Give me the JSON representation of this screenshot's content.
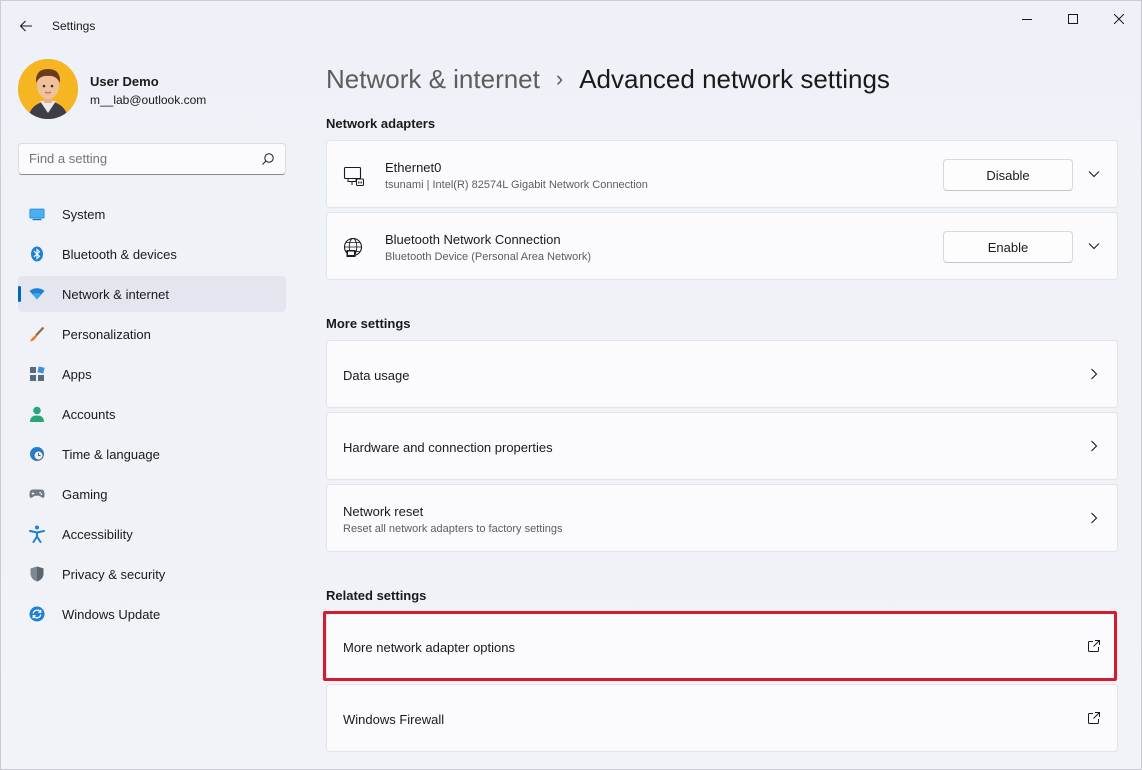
{
  "app": {
    "title": "Settings"
  },
  "profile": {
    "name": "User Demo",
    "email": "m__lab@outlook.com"
  },
  "search": {
    "placeholder": "Find a setting"
  },
  "sidebar": {
    "items": [
      {
        "label": "System",
        "icon": "system-icon"
      },
      {
        "label": "Bluetooth & devices",
        "icon": "bluetooth-icon"
      },
      {
        "label": "Network & internet",
        "icon": "wifi-icon",
        "active": true
      },
      {
        "label": "Personalization",
        "icon": "brush-icon"
      },
      {
        "label": "Apps",
        "icon": "apps-icon"
      },
      {
        "label": "Accounts",
        "icon": "person-icon"
      },
      {
        "label": "Time & language",
        "icon": "globe-clock-icon"
      },
      {
        "label": "Gaming",
        "icon": "gamepad-icon"
      },
      {
        "label": "Accessibility",
        "icon": "accessibility-icon"
      },
      {
        "label": "Privacy & security",
        "icon": "shield-icon"
      },
      {
        "label": "Windows Update",
        "icon": "update-icon"
      }
    ]
  },
  "breadcrumb": {
    "parent": "Network & internet",
    "separator": "›",
    "current": "Advanced network settings"
  },
  "sections": {
    "adapters_title": "Network adapters",
    "more_title": "More settings",
    "related_title": "Related settings"
  },
  "adapters": [
    {
      "name": "Ethernet0",
      "description": "tsunami | Intel(R) 82574L Gigabit Network Connection",
      "button": "Disable",
      "icon": "ethernet-icon"
    },
    {
      "name": "Bluetooth Network Connection",
      "description": "Bluetooth Device (Personal Area Network)",
      "button": "Enable",
      "icon": "globe-network-icon"
    }
  ],
  "more_settings": [
    {
      "title": "Data usage",
      "subtitle": ""
    },
    {
      "title": "Hardware and connection properties",
      "subtitle": ""
    },
    {
      "title": "Network reset",
      "subtitle": "Reset all network adapters to factory settings"
    }
  ],
  "related_settings": [
    {
      "title": "More network adapter options",
      "highlighted": true
    },
    {
      "title": "Windows Firewall",
      "highlighted": false
    }
  ],
  "colors": {
    "accent": "#0067c0",
    "highlight_border": "#d11d2d",
    "avatar_bg": "#f6b624"
  }
}
